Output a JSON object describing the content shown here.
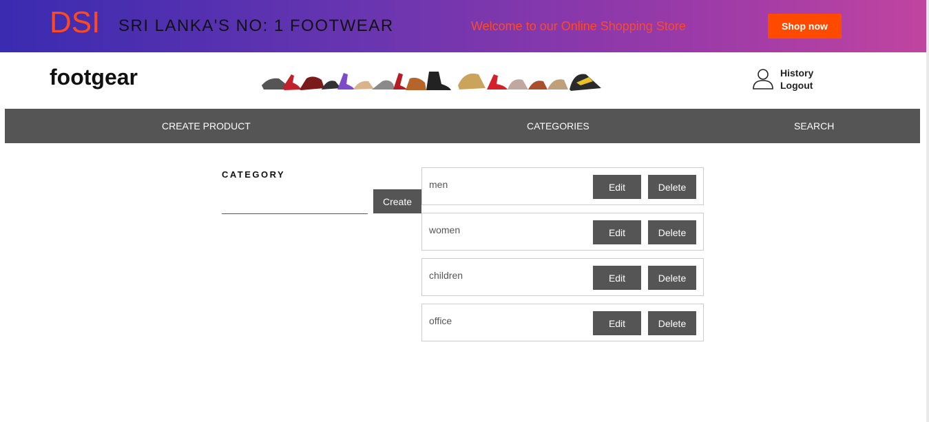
{
  "banner": {
    "brand": "DSI",
    "tagline": "SRI LANKA'S NO: 1 FOOTWEAR",
    "welcome": "Welcome to our Online Shopping Store",
    "shop_now": "Shop now"
  },
  "header": {
    "logo": "footgear",
    "user_links": {
      "history": "History",
      "logout": "Logout"
    }
  },
  "nav": {
    "items": [
      {
        "label": "CREATE PRODUCT"
      },
      {
        "label": "CATEGORIES"
      },
      {
        "label": "SEARCH"
      }
    ]
  },
  "category_form": {
    "heading": "CATEGORY",
    "input_value": "",
    "create_label": "Create"
  },
  "categories": [
    {
      "name": "men",
      "edit": "Edit",
      "delete": "Delete"
    },
    {
      "name": "women",
      "edit": "Edit",
      "delete": "Delete"
    },
    {
      "name": "children",
      "edit": "Edit",
      "delete": "Delete"
    },
    {
      "name": "office",
      "edit": "Edit",
      "delete": "Delete"
    }
  ],
  "colors": {
    "accent_orange": "#ff4a00",
    "nav_gray": "#555555",
    "gradient_start": "#3a2bb0",
    "gradient_end": "#c044a0"
  }
}
